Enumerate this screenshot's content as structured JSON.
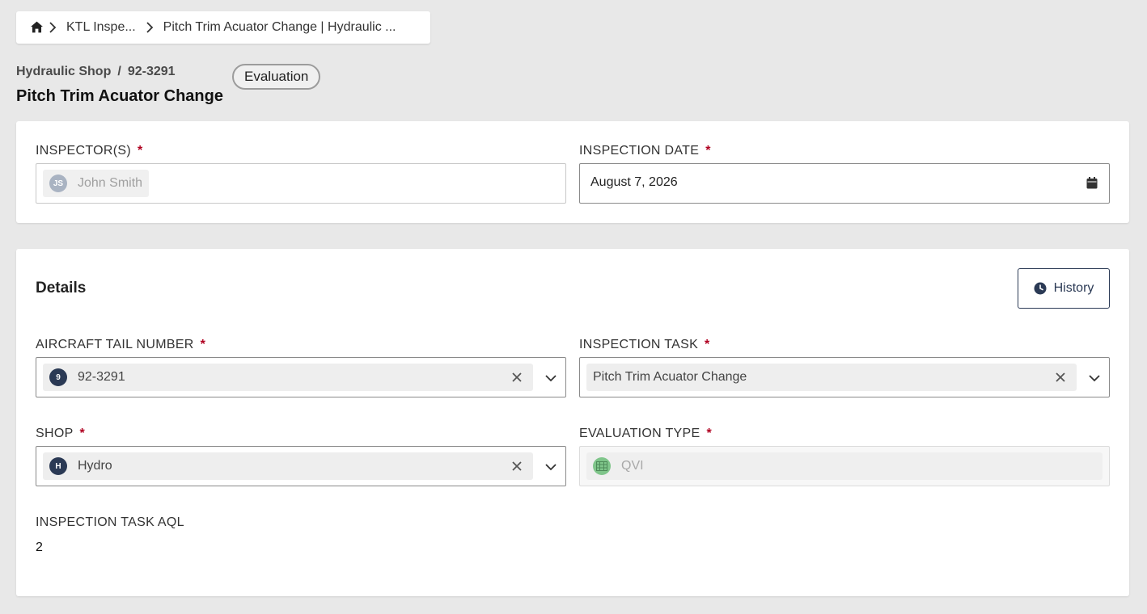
{
  "breadcrumb": {
    "items": [
      "KTL Inspe...",
      "Pitch Trim Acuator Change | Hydraulic ..."
    ]
  },
  "header": {
    "shop": "Hydraulic Shop",
    "divider": "/",
    "tail": "92-3291",
    "title": "Pitch Trim Acuator Change",
    "status": "Evaluation"
  },
  "inspection": {
    "inspectors_label": "INSPECTOR(S)",
    "inspector_initials": "JS",
    "inspector_name": "John Smith",
    "date_label": "INSPECTION DATE",
    "date_value": "August 7, 2026",
    "required_mark": "*"
  },
  "details": {
    "title": "Details",
    "history_label": "History",
    "tail_label": "AIRCRAFT TAIL NUMBER",
    "tail_avatar": "9",
    "tail_value": "92-3291",
    "task_label": "INSPECTION TASK",
    "task_value": "Pitch Trim Acuator Change",
    "shop_label": "SHOP",
    "shop_avatar": "H",
    "shop_value": "Hydro",
    "eval_label": "EVALUATION TYPE",
    "eval_value": "QVI",
    "aql_label": "INSPECTION TASK AQL",
    "aql_value": "2"
  },
  "colors": {
    "accent": "#2b3a55",
    "required": "#b00020",
    "eval_icon": "#7fc58a",
    "inspector_avatar": "#a9b3c2"
  },
  "icons": [
    "home-icon",
    "chevron-right-icon",
    "calendar-icon",
    "clock-icon",
    "close-icon",
    "chevron-down-icon",
    "grid-icon"
  ]
}
